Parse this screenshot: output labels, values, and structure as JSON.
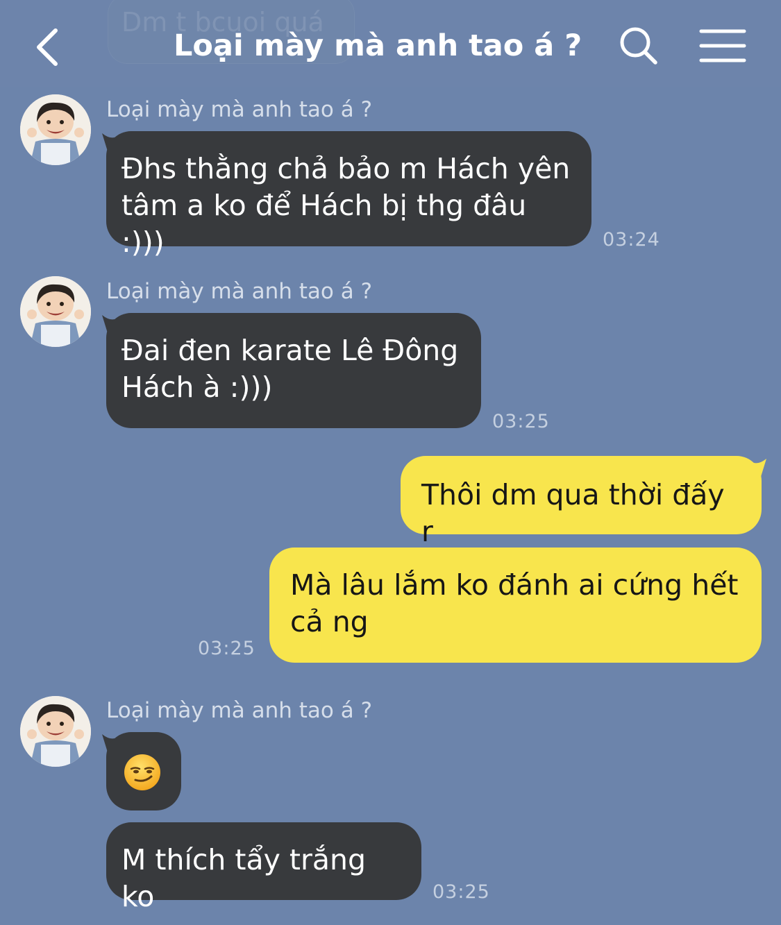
{
  "header": {
    "title": "Loại mày mà anh tao á ?",
    "ghost_preview": "Dm t bcuoi quá",
    "back_icon": "chevron-left-icon",
    "search_icon": "search-icon",
    "menu_icon": "hamburger-menu-icon"
  },
  "colors": {
    "background": "#6c84ab",
    "incoming_bubble": "#383a3d",
    "outgoing_bubble": "#f8e54d",
    "timestamp": "#c5d0e0"
  },
  "messages": [
    {
      "direction": "incoming",
      "sender": "Loại mày mà anh tao á ?",
      "text": "Đhs thằng chả bảo m Hách yên\ntâm a ko để Hách bị thg đâu :)))",
      "time": "03:24"
    },
    {
      "direction": "incoming",
      "sender": "Loại mày mà anh tao á ?",
      "text": "Đai đen karate Lê Đông\nHách à :)))",
      "time": "03:25"
    },
    {
      "direction": "outgoing",
      "text": "Thôi dm qua thời đấy r",
      "time": ""
    },
    {
      "direction": "outgoing",
      "text": "Mà lâu lắm ko đánh ai cứng hết\ncả ng",
      "time": "03:25"
    },
    {
      "direction": "incoming",
      "sender": "Loại mày mà anh tao á ?",
      "text": "",
      "emoji": "smirk-emoji",
      "time": ""
    },
    {
      "direction": "incoming",
      "text": "M thích tẩy trắng ko",
      "time": "03:25"
    }
  ]
}
